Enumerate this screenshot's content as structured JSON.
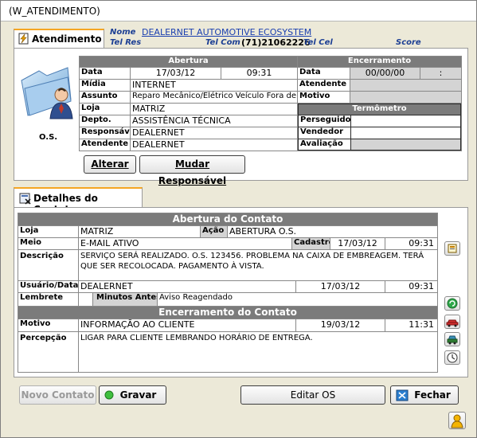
{
  "window": {
    "title": "(W_ATENDIMENTO)"
  },
  "header": {
    "tab_label": "Atendimento",
    "nome_label": "Nome",
    "nome_value": "DEALERNET AUTOMOTIVE ECOSYSTEM",
    "tel_res_label": "Tel Res",
    "tel_com_label": "Tel Com",
    "tel_com_value": "(71)21062226",
    "tel_cel_label": "Tel Cel",
    "score_label": "Score",
    "os_label": "O.S."
  },
  "abertura": {
    "title": "Abertura",
    "data_label": "Data",
    "data": "17/03/12",
    "hora": "09:31",
    "midia_label": "Mídia",
    "midia": "INTERNET",
    "assunto_label": "Assunto",
    "assunto": "Reparo Mecânico/Elétrico Veículo Fora de",
    "loja_label": "Loja",
    "loja": "MATRIZ",
    "depto_label": "Depto.",
    "depto": "ASSISTÊNCIA TÉCNICA",
    "responsavel_label": "Responsável",
    "responsavel": "DEALERNET",
    "atendente_label": "Atendente",
    "atendente": "DEALERNET"
  },
  "encerramento": {
    "title": "Encerramento",
    "data_label": "Data",
    "data": "00/00/00",
    "hora": ":",
    "atendente_label": "Atendente",
    "motivo_label": "Motivo"
  },
  "termometro": {
    "title": "Termômetro",
    "perseguidor_label": "Perseguidor",
    "vendedor_label": "Vendedor",
    "avaliacao_label": "Avaliação"
  },
  "actions": {
    "alterar": "Alterar",
    "mudar_responsavel": "Mudar Responsável"
  },
  "detalhes": {
    "tab_label": "Detalhes do Contato",
    "abertura_title": "Abertura do Contato",
    "loja_label": "Loja",
    "loja": "MATRIZ",
    "acao_label": "Ação",
    "acao": "ABERTURA O.S.",
    "meio_label": "Meio",
    "meio": "E-MAIL ATIVO",
    "cadastro_label": "Cadastro",
    "cadastro_data": "17/03/12",
    "cadastro_hora": "09:31",
    "descricao_label": "Descrição",
    "descricao": "SERVIÇO SERÁ REALIZADO. O.S. 123456. PROBLEMA NA CAIXA DE EMBREAGEM. TERÁ QUE SER RECOLOCADA. PAGAMENTO À VISTA.",
    "usuario_label": "Usuário/Data",
    "usuario": "DEALERNET",
    "usuario_data": "17/03/12",
    "usuario_hora": "09:31",
    "lembrete_label": "Lembrete",
    "minutos_label": "Minutos Antes",
    "aviso": "Aviso Reagendado",
    "encerramento_title": "Encerramento do Contato",
    "motivo_label": "Motivo",
    "motivo": "INFORMAÇÃO AO CLIENTE",
    "motivo_data": "19/03/12",
    "motivo_hora": "11:31",
    "percepcao_label": "Percepção",
    "percepcao": "LIGAR PARA CLIENTE LEMBRANDO HORÁRIO DE ENTREGA."
  },
  "footer": {
    "novo_contato": "Novo Contato",
    "gravar": "Gravar",
    "editar_os": "Editar OS",
    "fechar": "Fechar"
  },
  "colors": {
    "accent_tab": "#f5a623",
    "grid_header": "#7b7b7b",
    "link_blue": "#1a3fb0"
  }
}
